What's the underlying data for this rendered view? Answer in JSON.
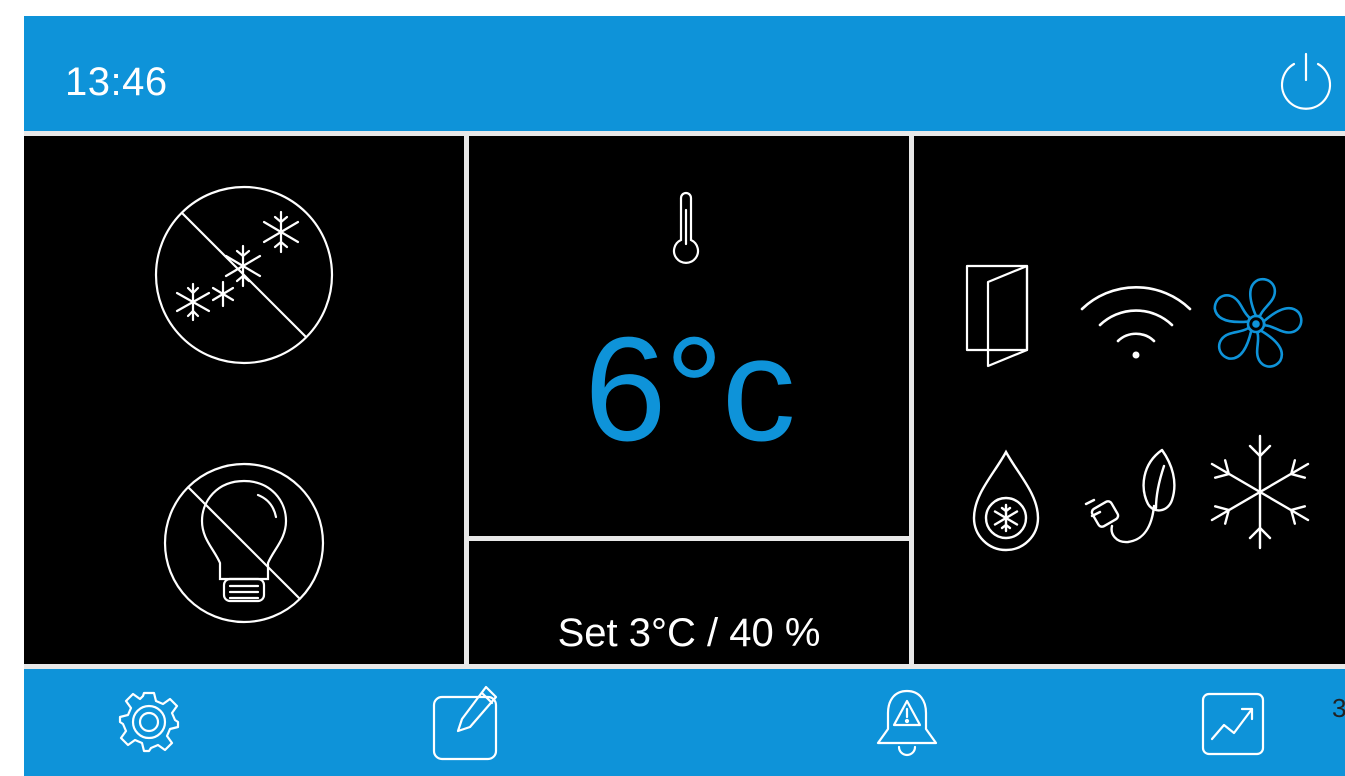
{
  "header": {
    "time": "13:46",
    "power_icon": "power-icon"
  },
  "main": {
    "temperature": "6°c",
    "setpoint": "Set 3°C / 40 %",
    "thermometer_icon": "thermometer-icon"
  },
  "left_controls": [
    {
      "name": "defrost-off",
      "icon": "snowflakes-crossed-icon"
    },
    {
      "name": "light-off",
      "icon": "bulb-crossed-icon"
    }
  ],
  "status_icons": [
    {
      "name": "door",
      "icon": "door-icon",
      "active": false
    },
    {
      "name": "wifi",
      "icon": "wifi-icon",
      "active": false
    },
    {
      "name": "fan",
      "icon": "fan-icon",
      "active": true
    },
    {
      "name": "defrost-water",
      "icon": "drop-snowflake-icon",
      "active": false
    },
    {
      "name": "eco",
      "icon": "plug-leaf-icon",
      "active": false
    },
    {
      "name": "cooling",
      "icon": "snowflake-icon",
      "active": false
    }
  ],
  "toolbar": [
    {
      "name": "settings",
      "icon": "gear-icon"
    },
    {
      "name": "edit",
      "icon": "edit-icon"
    },
    {
      "name": "alarms",
      "icon": "alarm-bell-icon"
    },
    {
      "name": "graph",
      "icon": "chart-icon"
    }
  ],
  "page_number": "3",
  "colors": {
    "accent": "#0e93d9",
    "background": "#000000",
    "foreground": "#ffffff"
  }
}
